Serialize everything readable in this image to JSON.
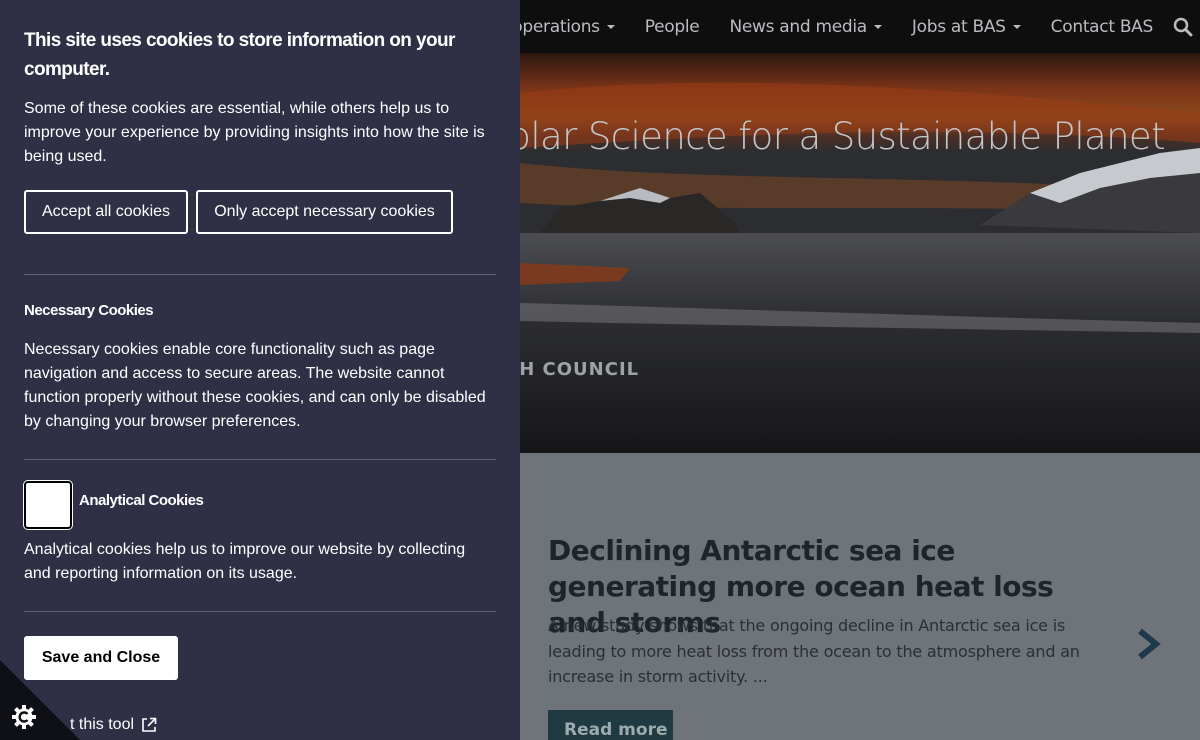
{
  "nav": {
    "items": [
      {
        "label": "Polar operations",
        "dropdown": true
      },
      {
        "label": "People",
        "dropdown": false
      },
      {
        "label": "News and media",
        "dropdown": true
      },
      {
        "label": "Jobs at BAS",
        "dropdown": true
      },
      {
        "label": "Contact BAS",
        "dropdown": false
      }
    ],
    "search_icon": "search-icon"
  },
  "hero": {
    "title": "Polar Science for a Sustainable Planet",
    "org_fragment": "CH COUNCIL"
  },
  "story": {
    "title": "Declining Antarctic sea ice generating more ocean heat loss and storms",
    "summary": "A new study shows that the ongoing decline in Antarctic sea ice is leading to more heat loss from the ocean to the atmosphere and an increase in storm activity. ...",
    "read_more": "Read more",
    "next_icon": "chevron-right-icon"
  },
  "cookie_panel": {
    "heading": "This site uses cookies to store information on your computer.",
    "intro": "Some of these cookies are essential, while others help us to improve your experience by providing insights into how the site is being used.",
    "accept_all": "Accept all cookies",
    "only_necessary": "Only accept necessary cookies",
    "necessary_title": "Necessary Cookies",
    "necessary_text": "Necessary cookies enable core functionality such as page navigation and access to secure areas. The website cannot function properly without these cookies, and can only be disabled by changing your browser preferences.",
    "analytical_title": "Analytical Cookies",
    "analytical_text": "Analytical cookies help us to improve our website by collecting and reporting information on its usage.",
    "analytical_enabled": false,
    "save_close": "Save and Close",
    "about_link": "t this tool",
    "corner_icon": "cookie-control-icon"
  },
  "colors": {
    "panel_bg": "#2f3045",
    "navbar_bg": "#0e0e0f",
    "read_more_bg": "#1f3a40",
    "arrow": "#1d3a4a"
  }
}
